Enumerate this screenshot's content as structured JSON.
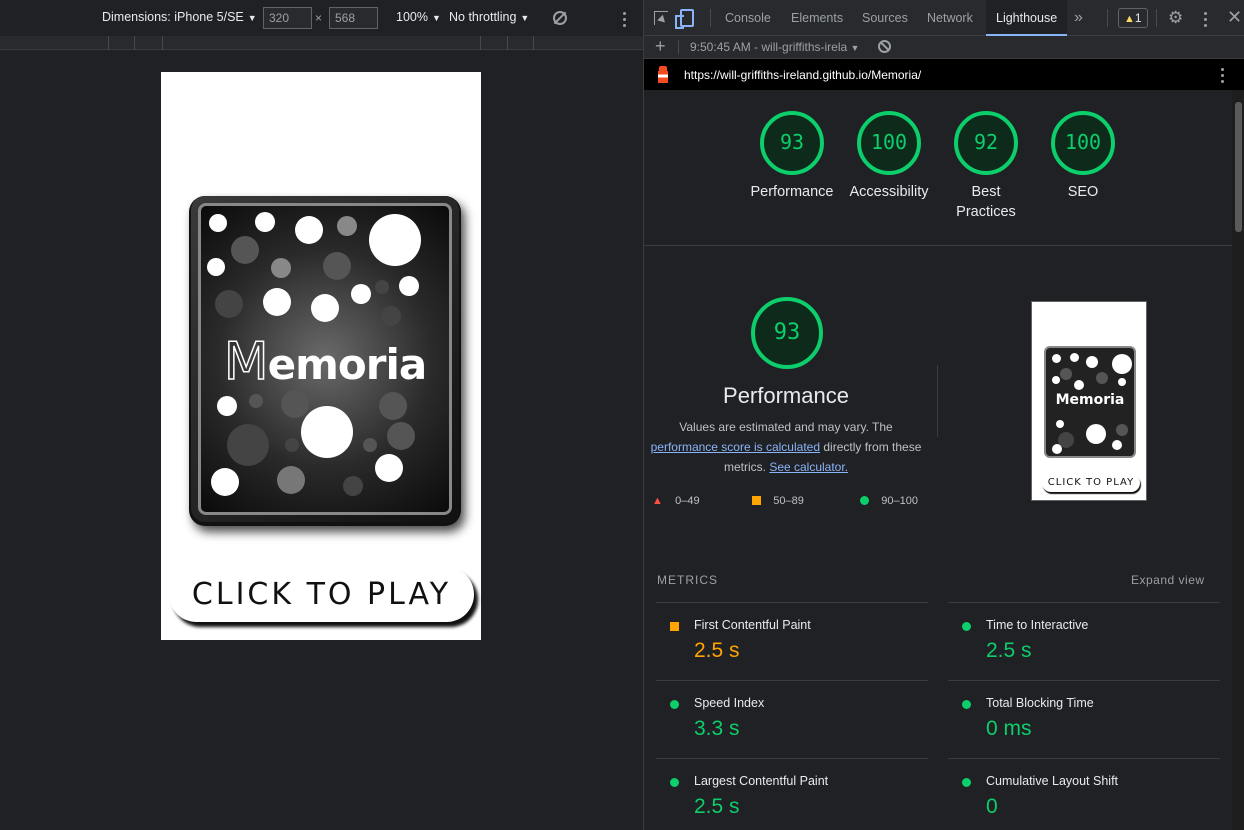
{
  "device_toolbar": {
    "dimensions_label": "Dimensions: iPhone 5/SE",
    "width": "320",
    "height": "568",
    "times": "×",
    "zoom": "100%",
    "throttling": "No throttling"
  },
  "app": {
    "logo_first": "M",
    "logo_rest": "emoria",
    "play_label": "CLICK TO PLAY",
    "mini_logo": "Memoria",
    "mini_play": "CLICK TO PLAY"
  },
  "devtools": {
    "tabs": [
      "Console",
      "Elements",
      "Sources",
      "Network",
      "Lighthouse"
    ],
    "more_tabs": "»",
    "warning_count": "1",
    "report_selector": "9:50:45 AM - will-griffiths-irela",
    "url": "https://will-griffiths-ireland.github.io/Memoria/"
  },
  "scores": [
    {
      "value": "93",
      "label1": "Performance",
      "label2": ""
    },
    {
      "value": "100",
      "label1": "Accessibility",
      "label2": ""
    },
    {
      "value": "92",
      "label1": "Best",
      "label2": "Practices"
    },
    {
      "value": "100",
      "label1": "SEO",
      "label2": ""
    }
  ],
  "performance": {
    "score": "93",
    "title": "Performance",
    "desc_1": "Values are estimated and may vary. The",
    "link_1": "performance score is calculated",
    "desc_2": "directly from these",
    "desc_3": "metrics.",
    "link_2": "See calculator.",
    "legend": [
      {
        "range": "0–49",
        "color": "#ff4e42"
      },
      {
        "range": "50–89",
        "color": "#ffa400"
      },
      {
        "range": "90–100",
        "color": "#0cce6b"
      }
    ]
  },
  "metrics": {
    "title": "METRICS",
    "expand": "Expand view",
    "items": [
      {
        "label": "First Contentful Paint",
        "value": "2.5 s",
        "status": "orange"
      },
      {
        "label": "Time to Interactive",
        "value": "2.5 s",
        "status": "green"
      },
      {
        "label": "Speed Index",
        "value": "3.3 s",
        "status": "green"
      },
      {
        "label": "Total Blocking Time",
        "value": "0 ms",
        "status": "green"
      },
      {
        "label": "Largest Contentful Paint",
        "value": "2.5 s",
        "status": "green"
      },
      {
        "label": "Cumulative Layout Shift",
        "value": "0",
        "status": "green"
      }
    ]
  }
}
